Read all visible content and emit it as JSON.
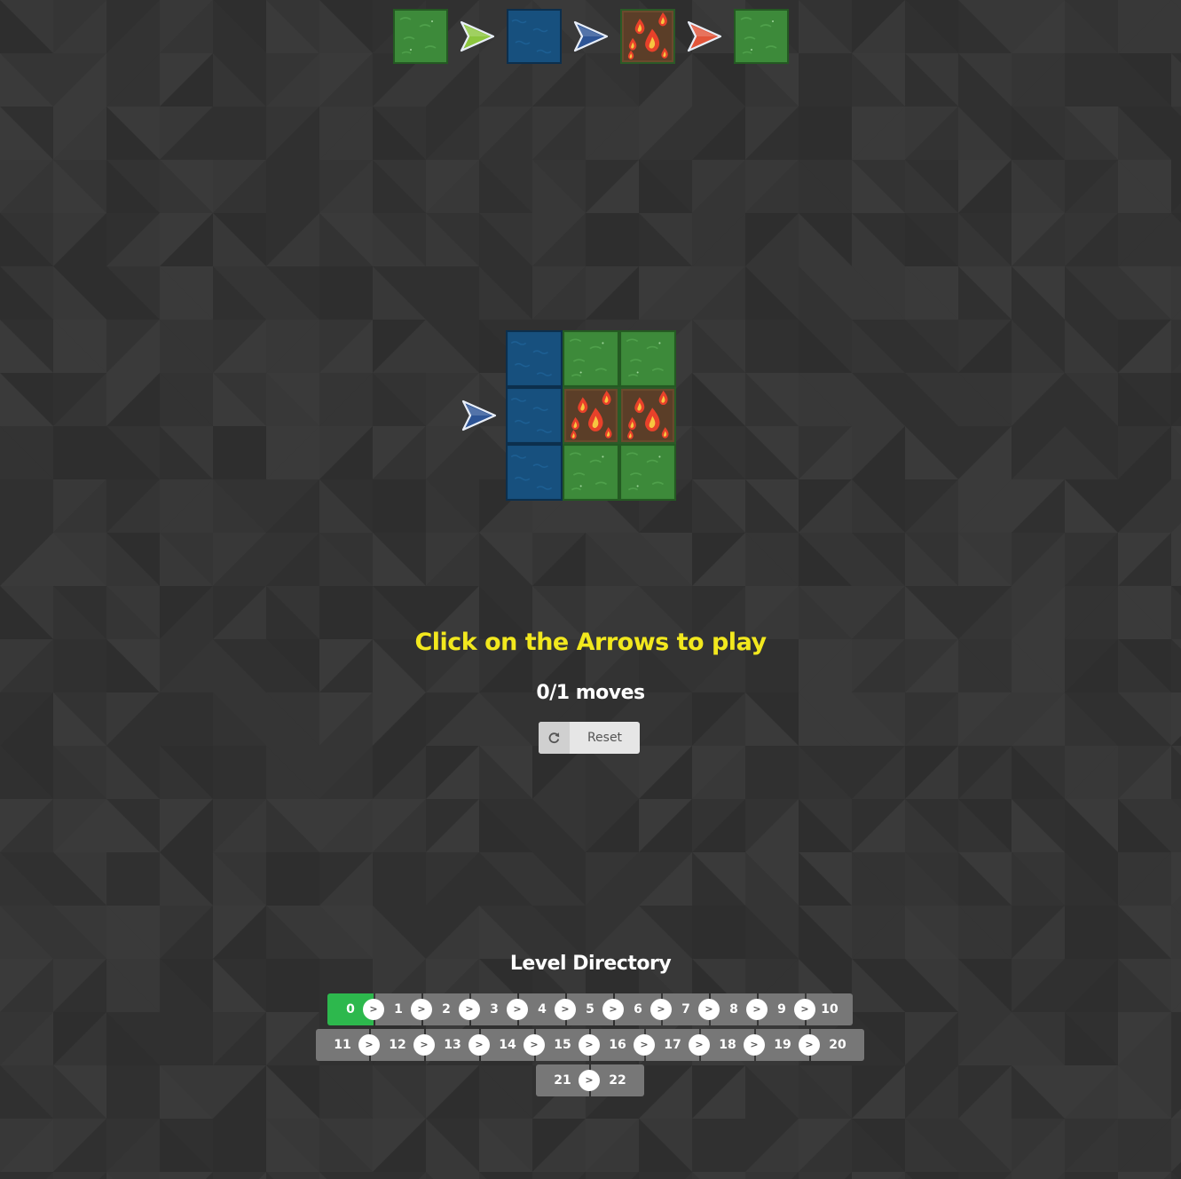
{
  "colors": {
    "background": "#333333",
    "grass": "#3d8a3a",
    "water": "#17507e",
    "fire_ground": "#6b4a2d",
    "arrow_green": "#8cc63f",
    "arrow_blue": "#2e5596",
    "arrow_orange": "#e2553a",
    "instruction": "#f2e81e",
    "level_active": "#2db84d",
    "level_default": "#777777"
  },
  "legend": {
    "items": [
      {
        "type": "tile",
        "tile": "grass"
      },
      {
        "type": "arrow",
        "color": "green"
      },
      {
        "type": "tile",
        "tile": "water"
      },
      {
        "type": "arrow",
        "color": "blue"
      },
      {
        "type": "tile",
        "tile": "fire"
      },
      {
        "type": "arrow",
        "color": "orange"
      },
      {
        "type": "tile",
        "tile": "grass"
      }
    ]
  },
  "board": {
    "rows": [
      [
        "water",
        "grass",
        "grass"
      ],
      [
        "water",
        "fire",
        "fire"
      ],
      [
        "water",
        "grass",
        "grass"
      ]
    ],
    "arrows": [
      {
        "row": 1,
        "color": "blue",
        "direction": "right"
      }
    ]
  },
  "instruction": "Click on the Arrows to play",
  "moves": {
    "text": "0/1 moves",
    "current": 0,
    "max": 1
  },
  "reset": {
    "label": "Reset",
    "icon": "refresh-icon"
  },
  "level_directory": {
    "title": "Level Directory",
    "separator": ">",
    "current": 0,
    "rows": [
      [
        "0",
        "1",
        "2",
        "3",
        "4",
        "5",
        "6",
        "7",
        "8",
        "9",
        "10"
      ],
      [
        "11",
        "12",
        "13",
        "14",
        "15",
        "16",
        "17",
        "18",
        "19",
        "20"
      ],
      [
        "21",
        "22"
      ]
    ]
  }
}
